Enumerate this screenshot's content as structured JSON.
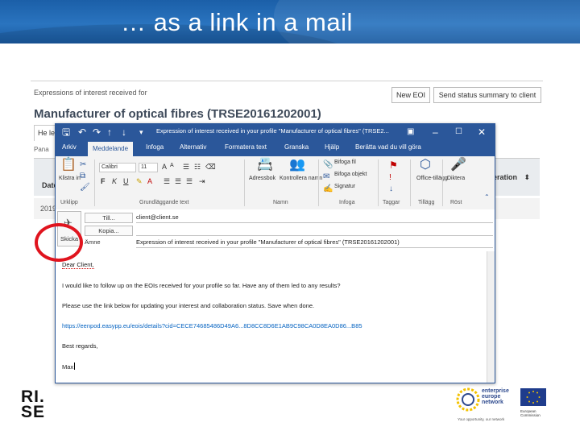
{
  "slide": {
    "title": "… as a link in a mail"
  },
  "webpage": {
    "expressions_label": "Expressions of interest received for",
    "new_eoi_button": "New EOI",
    "send_status_button": "Send status summary to client",
    "profile_title": "Manufacturer of optical fibres (TRSE20161202001)",
    "tab_label": "He le",
    "pana_label": "Pana",
    "date_header": "Date",
    "operation_header": "eration",
    "row_year": "2019"
  },
  "outlook": {
    "window_subject": "Expression of interest received in your profile \"Manufacturer of optical fibres\" (TRSE2...",
    "ribbon_tabs": [
      "Arkiv",
      "Meddelande",
      "Infoga",
      "Alternativ",
      "Formatera text",
      "Granska",
      "Hjälp",
      "Berätta vad du vill göra"
    ],
    "ribbon": {
      "paste_label": "Klistra in",
      "clipboard_group": "Urklipp",
      "font_name": "Calibri",
      "font_size": "11",
      "basic_text_group": "Grundläggande text",
      "address_book_label": "Adressbok",
      "check_names_label": "Kontrollera namn",
      "names_group": "Namn",
      "attach_file_label": "Bifoga fil",
      "attach_item_label": "Bifoga objekt",
      "signature_label": "Signatur",
      "include_group": "Infoga",
      "tags_group": "Taggar",
      "office_addins_label": "Office-tillägg",
      "addins_group": "Tillägg",
      "dictate_label": "Diktera",
      "voice_group": "Röst"
    },
    "send_label": "Skicka",
    "to_button": "Till...",
    "cc_button": "Kopia...",
    "subject_label": "Ämne",
    "to_value": "client@client.se",
    "cc_value": "",
    "subject_value": "Expression of interest received in your profile \"Manufacturer of optical fibres\" (TRSE20161202001)",
    "body": {
      "greeting": "Dear Client,",
      "line1": "I would like to follow up on the EOIs received for your profile so far. Have any of them led to any results?",
      "line2": "Please use the link below for updating your interest and collaboration status. Save when done.",
      "link": "https://eenpod.easypp.eu/eois/details?cid=CECE74685486D49A6...8D8CC8D6E1AB9C98CA0D8EA0D86...B85",
      "closing": "Best regards,",
      "signature": "Max"
    }
  },
  "logos": {
    "rise": "RI.\nSE",
    "een_text": "enterprise\neurope\nnetwork",
    "een_tagline": "Your opportunity, our network",
    "ec_text": "European\nCommission"
  },
  "colors": {
    "outlook_blue": "#2b579a",
    "title_bar_blue": "#2a74bf",
    "annotation_red": "#e0141e",
    "link_blue": "#0563c1"
  }
}
